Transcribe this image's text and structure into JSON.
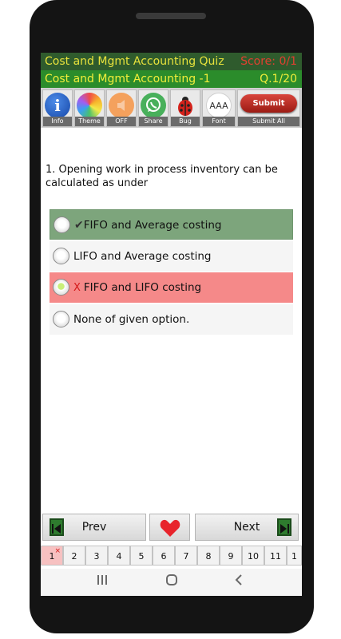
{
  "header": {
    "title": "Cost and Mgmt Accounting Quiz",
    "score": "Score: 0/1",
    "subtitle": "Cost and Mgmt Accounting -1",
    "question_number": "Q.1/20"
  },
  "toolbar": {
    "items": [
      {
        "label": "Info",
        "icon": "info-icon"
      },
      {
        "label": "Theme",
        "icon": "theme-icon"
      },
      {
        "label": "OFF",
        "icon": "sound-off-icon"
      },
      {
        "label": "Share",
        "icon": "whatsapp-share-icon"
      },
      {
        "label": "Bug",
        "icon": "ladybug-icon"
      },
      {
        "label": "Font",
        "icon": "font-size-icon"
      },
      {
        "label": "Submit All",
        "icon": "submit-icon"
      }
    ],
    "info_glyph": "i",
    "font_glyph": "AAA",
    "submit_label": "Submit"
  },
  "question": {
    "text": "1. Opening work in process inventory can be calculated as under",
    "options": [
      {
        "label": "FIFO and Average costing",
        "state": "correct",
        "marker": "✔"
      },
      {
        "label": "LIFO and Average costing",
        "state": "none",
        "marker": ""
      },
      {
        "label": "FIFO and LIFO costing",
        "state": "wrong-selected",
        "marker": "X"
      },
      {
        "label": "None of given option.",
        "state": "none",
        "marker": ""
      }
    ]
  },
  "navigation": {
    "prev_label": "Prev",
    "next_label": "Next",
    "favorite_icon": "heart-icon"
  },
  "question_strip": {
    "items": [
      "1",
      "2",
      "3",
      "4",
      "5",
      "6",
      "7",
      "8",
      "9",
      "10",
      "11",
      "1"
    ],
    "wrong_marker": "×"
  },
  "colors": {
    "header_dark": "#2f5b2d",
    "header_green": "#2b8c2b",
    "title_yellow": "#e8e23c",
    "score_red": "#e04030",
    "correct_bg": "#7da57c",
    "wrong_bg": "#f58989"
  }
}
